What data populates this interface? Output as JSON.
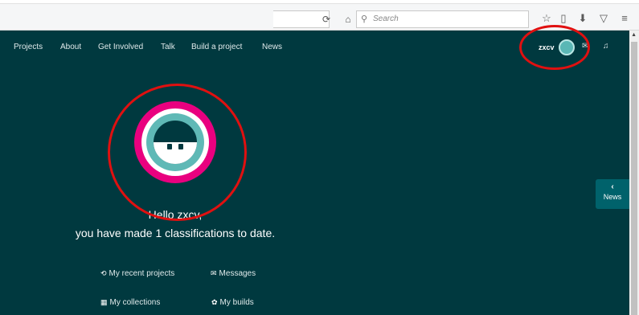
{
  "browser": {
    "search_placeholder": "Search",
    "icons": [
      "reload-icon",
      "home-icon",
      "search-icon",
      "star-icon",
      "clipboard-icon",
      "download-icon",
      "pocket-icon",
      "menu-icon"
    ]
  },
  "nav": {
    "items": [
      "Projects",
      "About",
      "Get Involved",
      "Talk",
      "Build a project",
      "News"
    ]
  },
  "user": {
    "username": "zxcv"
  },
  "home": {
    "greeting": "Hello zxcv,",
    "classifications": "you have made 1 classifications to date.",
    "links": [
      {
        "label": "My recent projects",
        "icon": "history-icon"
      },
      {
        "label": "Messages",
        "icon": "envelope-icon"
      },
      {
        "label": "My collections",
        "icon": "grid-icon"
      },
      {
        "label": "My builds",
        "icon": "cog-icon"
      }
    ]
  },
  "news_tab": {
    "chevron": "‹",
    "label": "News"
  },
  "colors": {
    "background": "#00393f",
    "avatar_pink": "#e9007f",
    "avatar_teal": "#5fb9b6",
    "annotation_red": "#e01010",
    "news_tab": "#00626b"
  }
}
